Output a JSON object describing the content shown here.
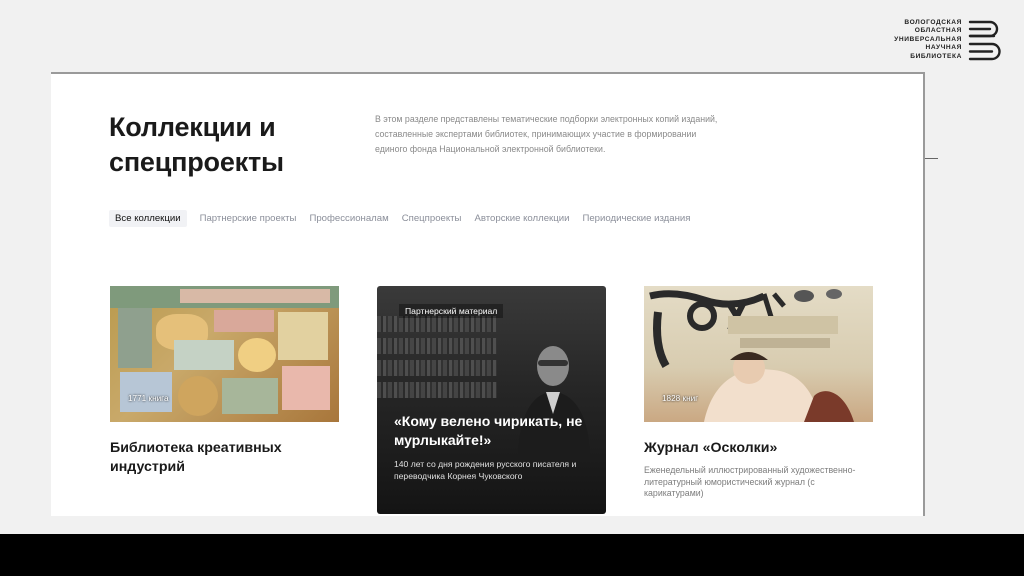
{
  "logo": {
    "lines": [
      "ВОЛОГОДСКАЯ",
      "ОБЛАСТНАЯ",
      "УНИВЕРСАЛЬНАЯ",
      "НАУЧНАЯ",
      "БИБЛИОТЕКА"
    ]
  },
  "page": {
    "title": "Коллекции и спецпроекты",
    "description": "В этом разделе представлены тематические подборки электронных копий изданий, составленные экспертами библиотек, принимающих участие в формировании единого фонда Национальной электронной библиотеки."
  },
  "tabs": [
    {
      "label": "Все коллекции",
      "active": true
    },
    {
      "label": "Партнерские проекты",
      "active": false
    },
    {
      "label": "Профессионалам",
      "active": false
    },
    {
      "label": "Спецпроекты",
      "active": false
    },
    {
      "label": "Авторские коллекции",
      "active": false
    },
    {
      "label": "Периодические издания",
      "active": false
    }
  ],
  "cards": [
    {
      "count": "1771 книга",
      "title": "Библиотека креативных индустрий",
      "description": ""
    },
    {
      "tag": "Партнерский материал",
      "title": "«Кому велено чирикать, не мурлыкайте!»",
      "description": "140 лет со дня рождения русского писателя и переводчика Корнея Чуковского"
    },
    {
      "count": "1828 книг",
      "title": "Журнал «Осколки»",
      "description": "Еженедельный иллюстрированный художественно-литературный юмористический журнал (с карикатурами)"
    }
  ]
}
